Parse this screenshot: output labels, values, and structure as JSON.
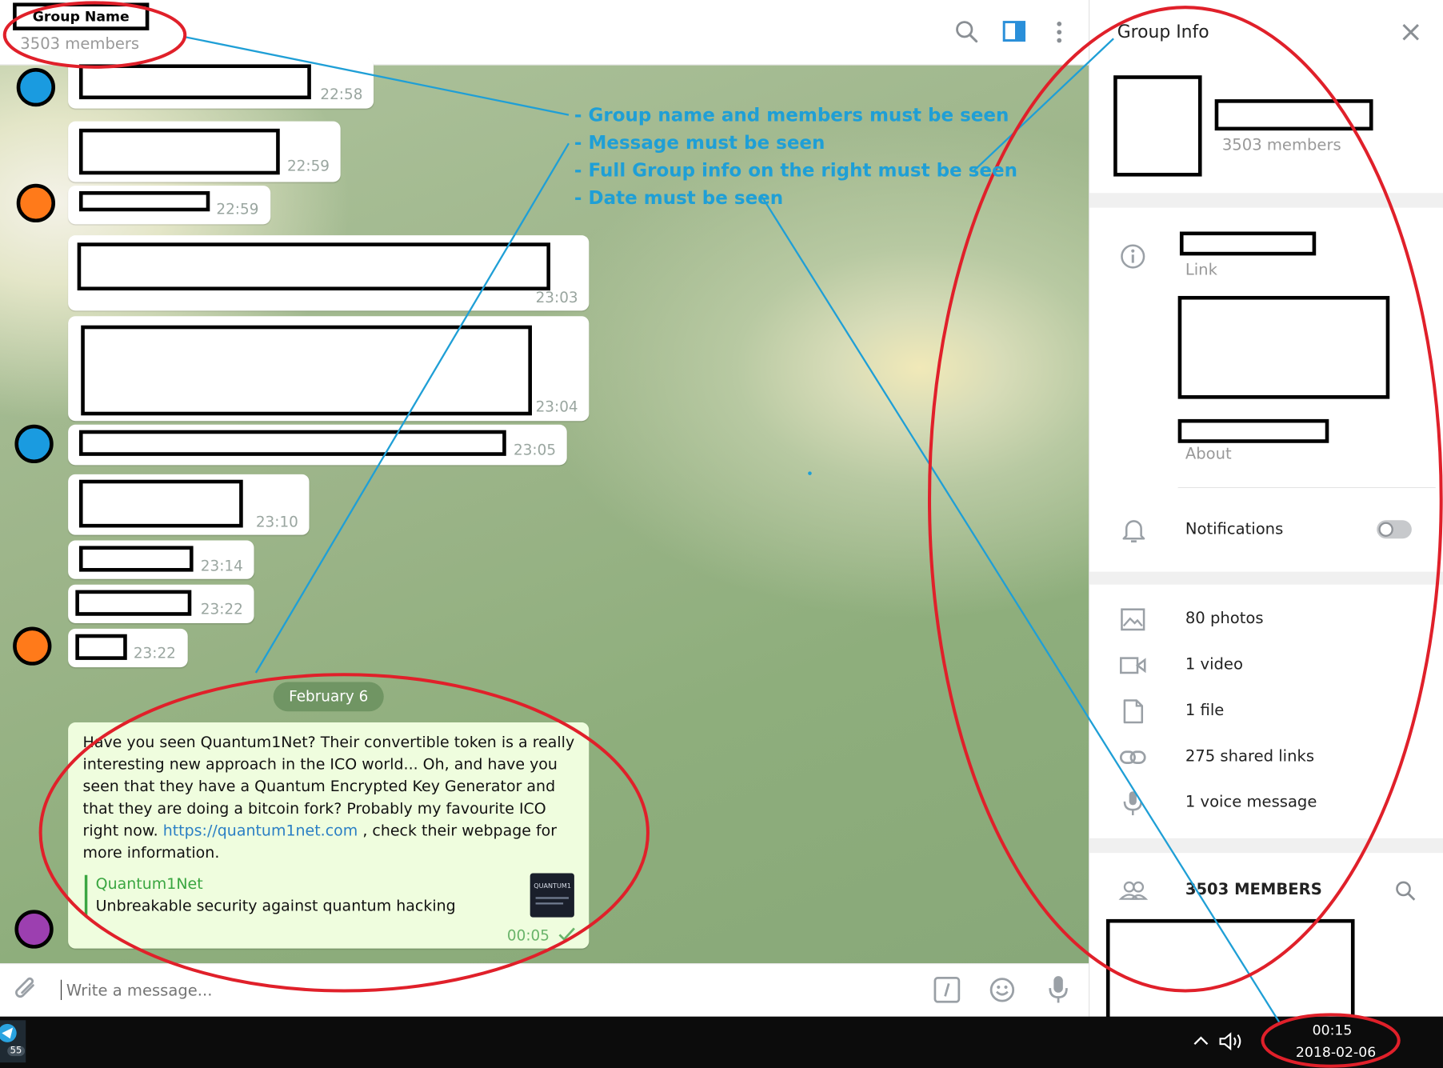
{
  "header": {
    "group_name": "Group Name",
    "members_count": "3503 members"
  },
  "messages": {
    "times": [
      "22:58",
      "22:59",
      "22:59",
      "23:03",
      "23:04",
      "23:05",
      "23:10",
      "23:14",
      "23:22",
      "23:22"
    ],
    "date_separator": "February 6",
    "featured": {
      "text_before_link": "Have you seen Quantum1Net? Their convertible token is a really interesting new approach in the ICO world... Oh, and have you seen that they have a Quantum Encrypted Key Generator and that they are doing a bitcoin fork? Probably my favourite ICO right now.",
      "link": "https://quantum1net.com",
      "text_after_link": ", check their webpage for more information.",
      "preview_title": "Quantum1Net",
      "preview_desc": "Unbreakable security against quantum hacking",
      "thumb_text": "QUANTUM1",
      "time": "00:05"
    }
  },
  "composer": {
    "placeholder": "Write a message..."
  },
  "annotations": [
    "- Group name and members must be seen",
    "- Message must be seen",
    "- Full Group info on the right must be seen",
    "- Date must be seen"
  ],
  "panel": {
    "title": "Group Info",
    "members": "3503 members",
    "link_label": "Link",
    "about_label": "About",
    "notifications_label": "Notifications",
    "notifications_on": false,
    "media": [
      {
        "icon": "photo-icon",
        "label": "80 photos"
      },
      {
        "icon": "video-icon",
        "label": "1 video"
      },
      {
        "icon": "file-icon",
        "label": "1 file"
      },
      {
        "icon": "link-icon",
        "label": "275 shared links"
      },
      {
        "icon": "microphone-icon",
        "label": "1 voice message"
      }
    ],
    "members_header": "3503 MEMBERS"
  },
  "taskbar": {
    "badge": "55",
    "time": "00:15",
    "date": "2018-02-06"
  },
  "colors": {
    "annotation_blue": "#1f9fd6",
    "annotation_red": "#e0202a",
    "accent_blue": "#2a8fd9",
    "link_blue": "#2a7fc4",
    "preview_green": "#3aa641",
    "featured_bubble": "#effdde",
    "avatar_blue": "#1a9be0",
    "avatar_orange": "#ff7a1a",
    "avatar_purple": "#9c3fb0"
  }
}
